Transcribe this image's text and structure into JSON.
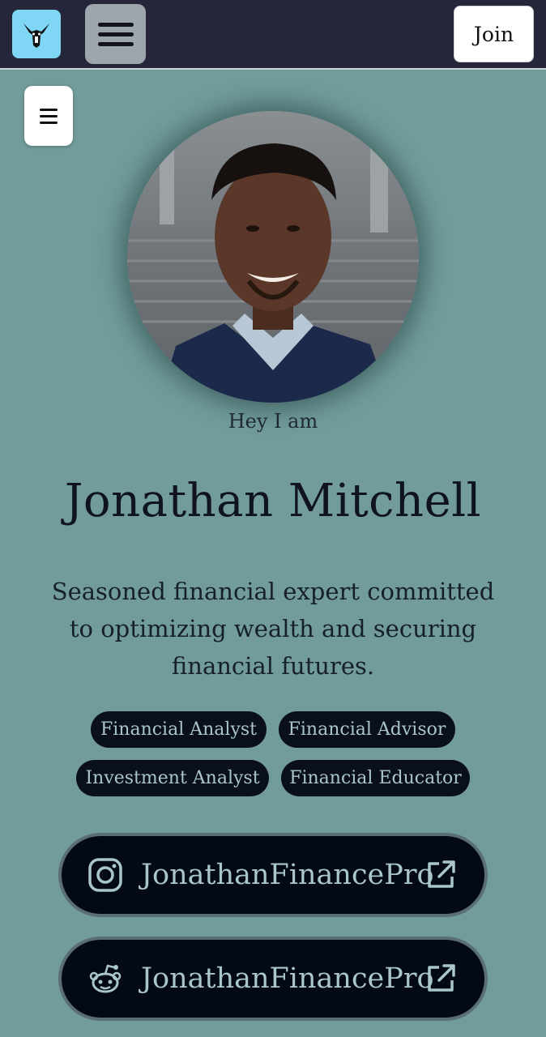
{
  "header": {
    "logo_icon": "bull-logo-icon",
    "menu_icon": "hamburger-icon",
    "join_label": "Join"
  },
  "profile": {
    "greeting": "Hey I am",
    "name": "Jonathan Mitchell",
    "bio": "Seasoned financial expert committed to optimizing wealth and securing financial futures.",
    "tags": [
      "Financial Analyst",
      "Financial Advisor",
      "Investment Analyst",
      "Financial Educator"
    ]
  },
  "links": [
    {
      "icon": "instagram-icon",
      "label": "JonathanFinancePro",
      "action_icon": "external-link-icon"
    },
    {
      "icon": "reddit-icon",
      "label": "JonathanFinancePro",
      "action_icon": "external-link-icon"
    }
  ],
  "colors": {
    "background": "#729b9b",
    "topbar": "#252639",
    "accent_logo": "#7fd6f5",
    "pill": "#0a0f1c",
    "pill_text": "#a9c6c9"
  }
}
